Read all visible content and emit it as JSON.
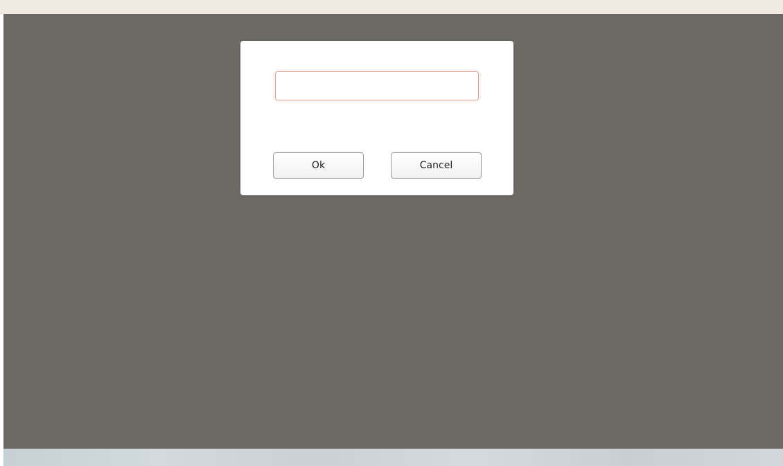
{
  "dialog": {
    "input": {
      "value": "",
      "placeholder": ""
    },
    "ok_label": "Ok",
    "cancel_label": "Cancel"
  },
  "colors": {
    "overlay": "#6c6864",
    "top_strip": "#efe9e1",
    "input_border": "#e3a48f",
    "dialog_background": "#ffffff"
  }
}
